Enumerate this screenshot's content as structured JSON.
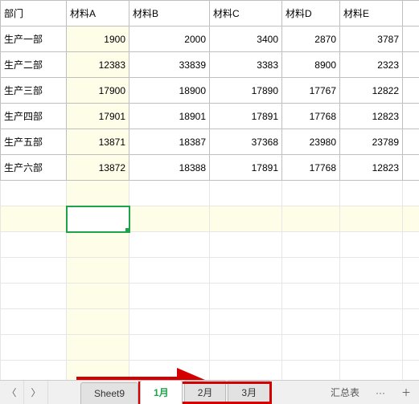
{
  "chart_data": {
    "type": "table",
    "columns": [
      "部门",
      "材料A",
      "材料B",
      "材料C",
      "材料D",
      "材料E"
    ],
    "rows": [
      [
        "生产一部",
        1900,
        2000,
        3400,
        2870,
        3787
      ],
      [
        "生产二部",
        12383,
        33839,
        3383,
        8900,
        2323
      ],
      [
        "生产三部",
        17900,
        18900,
        17890,
        17767,
        12822
      ],
      [
        "生产四部",
        17901,
        18901,
        17891,
        17768,
        12823
      ],
      [
        "生产五部",
        13871,
        18387,
        37368,
        23980,
        23789
      ],
      [
        "生产六部",
        13872,
        18388,
        17891,
        17768,
        12823
      ]
    ]
  },
  "headers": {
    "c0": "部门",
    "c1": "材料A",
    "c2": "材料B",
    "c3": "材料C",
    "c4": "材料D",
    "c5": "材料E"
  },
  "rows": {
    "r0": {
      "dept": "生产一部",
      "a": "1900",
      "b": "2000",
      "c": "3400",
      "d": "2870",
      "e": "3787"
    },
    "r1": {
      "dept": "生产二部",
      "a": "12383",
      "b": "33839",
      "c": "3383",
      "d": "8900",
      "e": "2323"
    },
    "r2": {
      "dept": "生产三部",
      "a": "17900",
      "b": "18900",
      "c": "17890",
      "d": "17767",
      "e": "12822"
    },
    "r3": {
      "dept": "生产四部",
      "a": "17901",
      "b": "18901",
      "c": "17891",
      "d": "17768",
      "e": "12823"
    },
    "r4": {
      "dept": "生产五部",
      "a": "13871",
      "b": "18387",
      "c": "37368",
      "d": "23980",
      "e": "23789"
    },
    "r5": {
      "dept": "生产六部",
      "a": "13872",
      "b": "18388",
      "c": "17891",
      "d": "17768",
      "e": "12823"
    }
  },
  "tabs": {
    "sheet9": "Sheet9",
    "m1": "1月",
    "m2": "2月",
    "m3": "3月",
    "summary": "汇总表"
  },
  "nav": {
    "prev": "〈",
    "next": "〉",
    "more": "···",
    "add": "＋"
  }
}
